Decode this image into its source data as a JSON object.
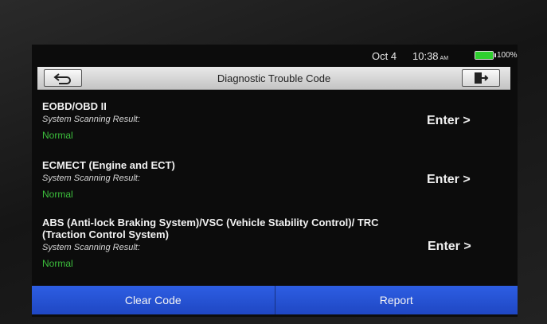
{
  "statusbar": {
    "date": "Oct 4",
    "time": "10:38",
    "ampm": "AM",
    "battery_text": "100%",
    "battery_level": 1.0,
    "battery_color": "#2fd02f"
  },
  "titlebar": {
    "title": "Diagnostic Trouble Code",
    "back_icon": "back-arrow-icon",
    "exit_icon": "exit-door-icon"
  },
  "items": [
    {
      "title": "EOBD/OBD II",
      "subtitle": "System Scanning Result:",
      "status": "Normal",
      "enter": "Enter >"
    },
    {
      "title": "ECMECT (Engine and ECT)",
      "subtitle": "System Scanning Result:",
      "status": "Normal",
      "enter": "Enter >"
    },
    {
      "title": "ABS (Anti-lock Braking System)/VSC (Vehicle Stability Control)/ TRC (Traction Control System)",
      "subtitle": "System Scanning Result:",
      "status": "Normal",
      "enter": "Enter >"
    }
  ],
  "bottom": {
    "clear_code": "Clear Code",
    "report": "Report"
  },
  "colors": {
    "status_normal": "#3cbf3c",
    "button_blue": "#2d5ee3"
  }
}
